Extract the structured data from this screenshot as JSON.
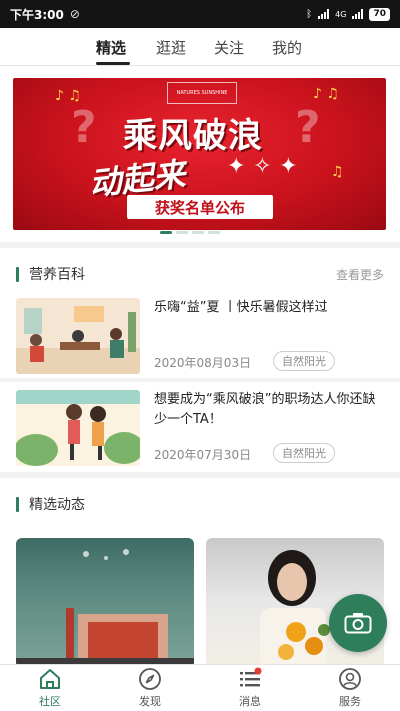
{
  "status_bar": {
    "time": "下午3:00",
    "network": "4G",
    "battery": "70"
  },
  "top_tabs": [
    {
      "label": "精选",
      "active": true
    },
    {
      "label": "逛逛",
      "active": false
    },
    {
      "label": "关注",
      "active": false
    },
    {
      "label": "我的",
      "active": false
    }
  ],
  "banner": {
    "brand": "NATURES SUNSHINE",
    "headline": "乘风破浪",
    "subheadline": "动起来",
    "caption": "获奖名单公布",
    "active_slide": 1,
    "slide_count": 4
  },
  "nutrition": {
    "title": "营养百科",
    "more": "查看更多",
    "articles": [
      {
        "title": "乐嗨“益”夏 丨快乐暑假这样过",
        "date": "2020年08月03日",
        "tag": "自然阳光"
      },
      {
        "title": "想要成为“乘风破浪”的职场达人你还缺少一个TA！",
        "date": "2020年07月30日",
        "tag": "自然阳光"
      }
    ]
  },
  "feed": {
    "title": "精选动态"
  },
  "bottom_nav": [
    {
      "label": "社区",
      "icon": "home-icon",
      "active": true
    },
    {
      "label": "发现",
      "icon": "compass-icon",
      "active": false
    },
    {
      "label": "消息",
      "icon": "message-list-icon",
      "active": false,
      "badge": true
    },
    {
      "label": "服务",
      "icon": "user-service-icon",
      "active": false
    }
  ],
  "colors": {
    "accent": "#2e7d5b",
    "banner_red": "#d0141f"
  }
}
